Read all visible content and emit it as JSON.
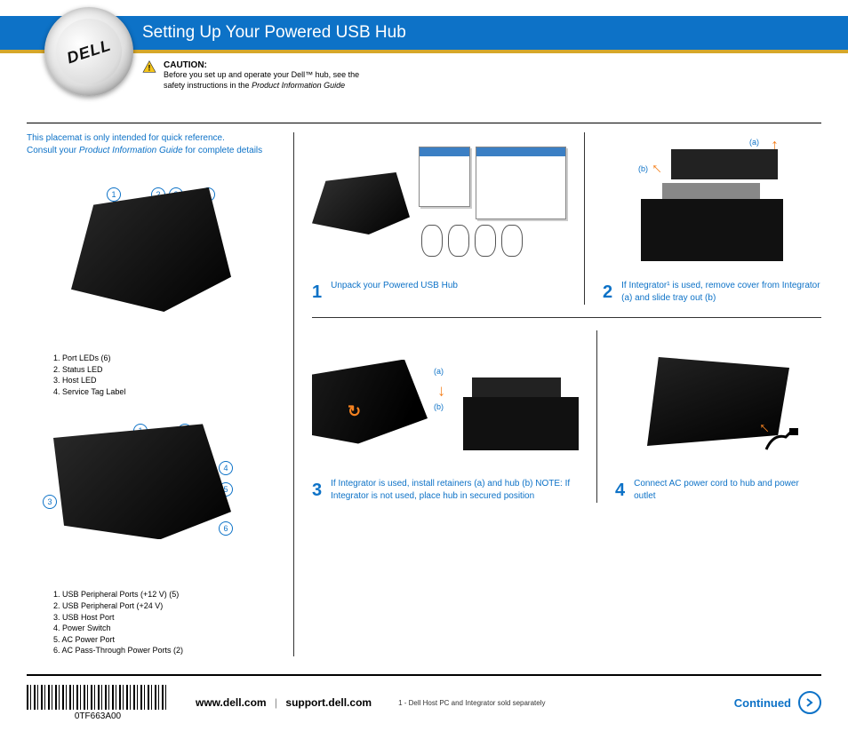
{
  "brand": "DELL",
  "title": "Setting Up Your Powered USB Hub",
  "caution": {
    "label": "CAUTION:",
    "line1": "Before you set up and operate your Dell™ hub, see the",
    "line2": "safety instructions in the ",
    "doc": "Product Information Guide"
  },
  "intro": {
    "line1": "This placemat is only intended for quick reference.",
    "line2a": "Consult your ",
    "line2b": "Product Information Guide",
    "line2c": " for complete details"
  },
  "front_callouts": {
    "c1": "1",
    "c2": "2",
    "c3": "3",
    "c4": "4"
  },
  "front_legend": {
    "l1": "1. Port LEDs (6)",
    "l2": "2. Status LED",
    "l3": "3. Host LED",
    "l4": "4. Service Tag Label"
  },
  "back_callouts": {
    "c1": "1",
    "c2": "2",
    "c3": "3",
    "c4": "4",
    "c5": "5",
    "c6": "6"
  },
  "back_legend": {
    "l1": "1. USB Peripheral Ports (+12 V) (5)",
    "l2": "2. USB Peripheral Port (+24 V)",
    "l3": "3. USB Host Port",
    "l4": "4. Power Switch",
    "l5": "5. AC Power Port",
    "l6": "6. AC Pass-Through Power Ports (2)"
  },
  "steps": {
    "s1": {
      "num": "1",
      "text": "Unpack your Powered USB Hub"
    },
    "s2": {
      "num": "2",
      "text": "If Integrator¹ is used, remove cover from Integrator (a) and slide tray out (b)",
      "ma": "(a)",
      "mb": "(b)"
    },
    "s3": {
      "num": "3",
      "text": "If Integrator is used, install retainers (a) and hub (b) NOTE: If Integrator is not used, place hub in secured position",
      "ma": "(a)",
      "mb": "(b)"
    },
    "s4": {
      "num": "4",
      "text": "Connect AC power cord to hub and power outlet"
    }
  },
  "footer": {
    "barcode": "0TF663A00",
    "url1": "www.dell.com",
    "sep": "|",
    "url2": "support.dell.com",
    "footnote": "1 - Dell Host PC and Integrator sold separately",
    "continued": "Continued"
  }
}
